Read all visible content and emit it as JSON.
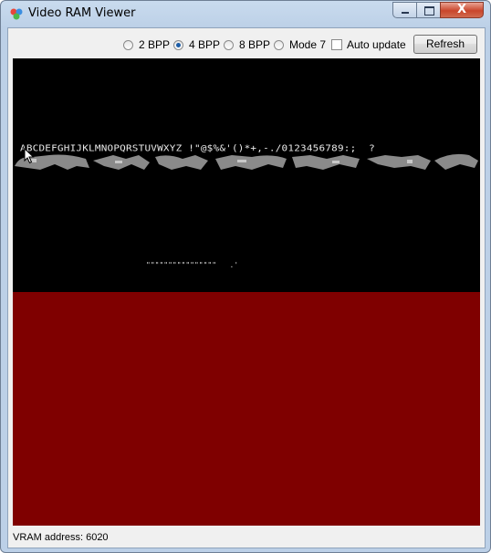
{
  "window": {
    "title": "Video RAM Viewer",
    "close_glyph": "X"
  },
  "toolbar": {
    "modes": [
      {
        "label": "2 BPP",
        "selected": false
      },
      {
        "label": "4 BPP",
        "selected": true
      },
      {
        "label": "8 BPP",
        "selected": false
      },
      {
        "label": "Mode 7",
        "selected": false
      }
    ],
    "auto_update_label": "Auto update",
    "auto_update_checked": false,
    "refresh_label": "Refresh"
  },
  "vram": {
    "font_row_text": "ABCDEFGHIJKLMNOPQRSTUVWXYZ !\"@$%&'()*+,-./0123456789:;  ?",
    "small_row_text": "\"\"\"\"\"\"\"\"\"\"\"\"\"\"\"\"   .'",
    "top_bg_color": "#000000",
    "bottom_bg_color": "#7f0000"
  },
  "status": {
    "text": "VRAM address: 6020"
  }
}
